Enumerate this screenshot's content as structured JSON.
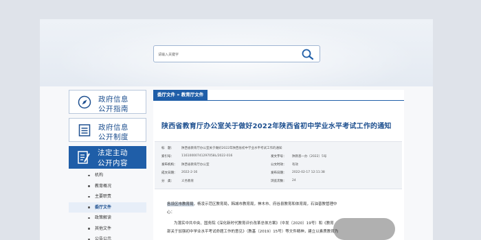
{
  "search": {
    "placeholder": "请输入关键字",
    "button_icon": "search-icon"
  },
  "nav": {
    "cards": [
      {
        "icon": "compass-icon",
        "line1": "政府信息",
        "line2": "公开指南"
      },
      {
        "icon": "document-list-icon",
        "line1": "政府信息",
        "line2": "公开制度"
      }
    ],
    "active": {
      "icon": "edit-document-icon",
      "line1": "法定主动",
      "line2": "公开内容"
    },
    "sub_items": [
      "机构",
      "教育概况",
      "主要职责",
      "委厅文件",
      "政策解读",
      "其他文件",
      "公告公示"
    ],
    "active_sub": "委厅文件"
  },
  "content": {
    "breadcrumb": "委厅文件 » 教育厅文件",
    "title": "陕西省教育厅办公室关于做好2022年陕西省初中学业水平考试工作的通知",
    "meta": [
      {
        "k": "标　题：",
        "v": "陕西省教育厅办公室关于做好2022年陕西省初中学业水平考试工作的通知",
        "k2": "",
        "v2": ""
      },
      {
        "k": "索引号：",
        "v": "11610000741297058L/2022-016",
        "k2": "发文字号：",
        "v2": "陕教基一办〔2022〕5号"
      },
      {
        "k": "发布机构：",
        "v": "陕西省教育厅办公室",
        "k2": "公文时效：",
        "v2": "有效"
      },
      {
        "k": "成文日期：",
        "v": "2022-2-16",
        "k2": "发布日期：",
        "v2": "2022-02-17 12:11:38"
      },
      {
        "k": "分　类：",
        "v": "义务教育",
        "k2": "浏览次数：",
        "v2": "24"
      }
    ],
    "para1_hl": "各设区市教育局",
    "para1": "，杨凌示范区教育局，韩城市教育局，神木市、府谷县教育和体育局，石油普教管理中",
    "para1_cont": "心：",
    "para2": "为落实中共中央、国务院《深化新时代教育评价改革总体方案》（中发〔2020〕19号）和《教育",
    "para3": "部关于加强初中学业水平考试命题工作的意见》（教基〔2019〕15号）等文件精神，建立以素质教育为"
  }
}
